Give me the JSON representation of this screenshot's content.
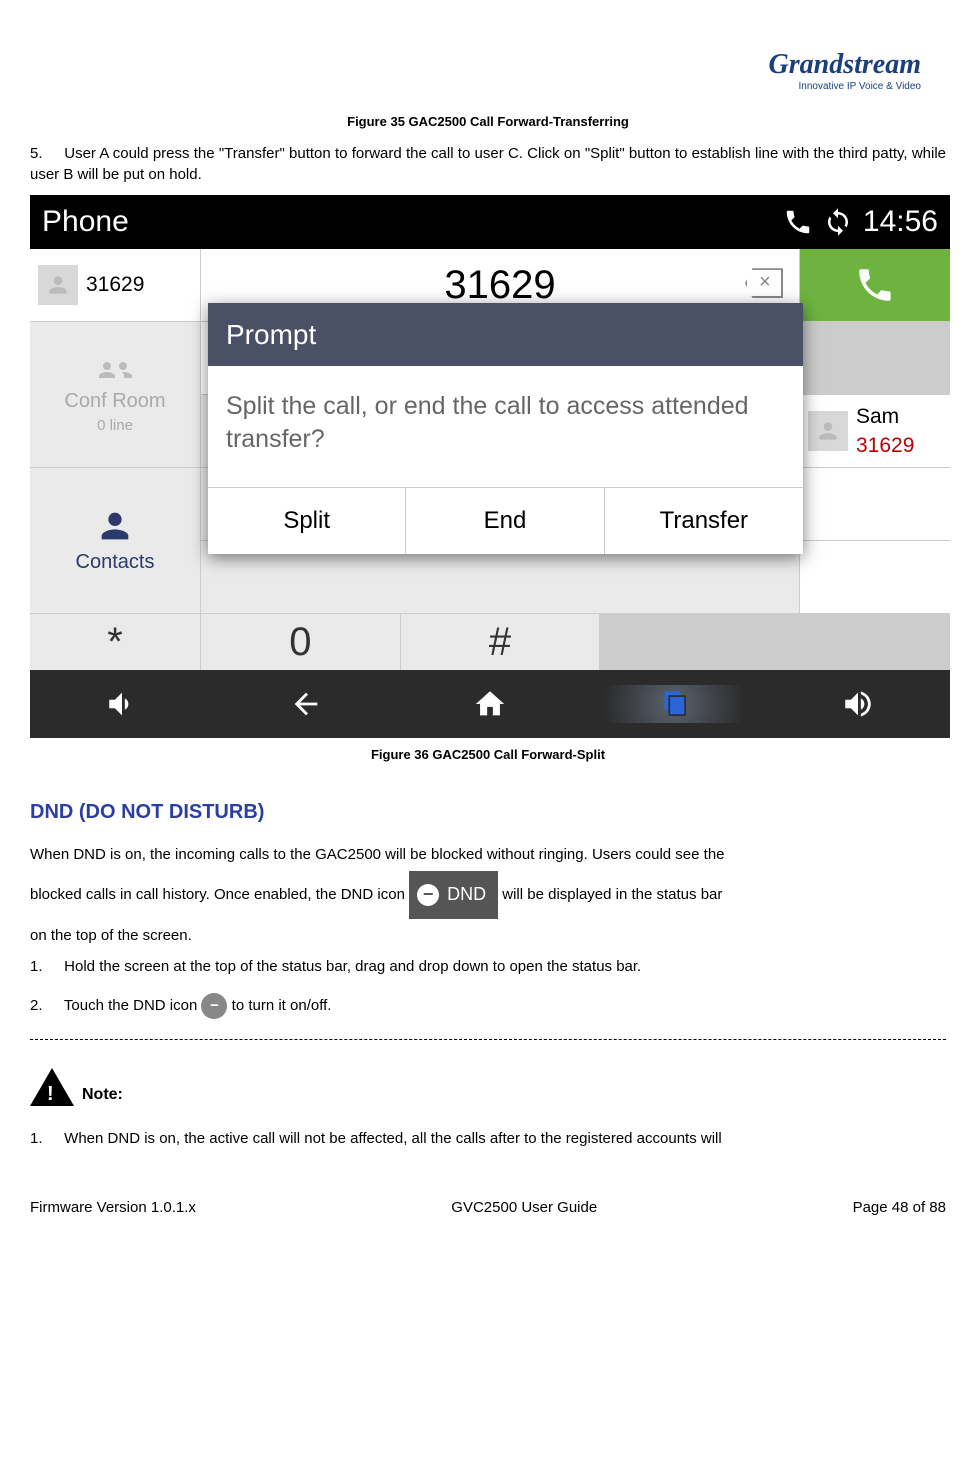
{
  "logo": {
    "brand": "Grandstream",
    "tag": "Innovative IP Voice & Video"
  },
  "caption35": "Figure 35 GAC2500 Call Forward-Transferring",
  "step5": {
    "num": "5.",
    "text": "User A could press the \"Transfer\" button to forward the call to user C. Click on \"Split\" button to establish line with the third patty, while user B will be put on hold."
  },
  "screenshot": {
    "statusbar": {
      "title": "Phone",
      "time": "14:56"
    },
    "num_field": "31629",
    "left": [
      {
        "name": "31629",
        "sub": ""
      },
      {
        "name": "31629",
        "sub": "31629"
      },
      {
        "name": "Sam",
        "sub": "31629"
      }
    ],
    "right": {
      "conf": "Conf Room",
      "conf_sub": "0 line",
      "contacts": "Contacts"
    },
    "keys": {
      "star": "*",
      "zero": "0",
      "hash": "#"
    },
    "prompt": {
      "title": "Prompt",
      "body": "Split the call, or end the call to access attended transfer?",
      "b1": "Split",
      "b2": "End",
      "b3": "Transfer"
    }
  },
  "caption36": "Figure 36 GAC2500 Call Forward-Split",
  "dnd_heading": "DND (DO NOT DISTURB)",
  "dnd_para_a": "When DND is on, the incoming calls to the GAC2500 will be blocked without ringing. Users could see the",
  "dnd_para_b": "blocked calls in call history. Once enabled, the DND icon ",
  "dnd_badge": "DND",
  "dnd_para_c": " will be displayed in the status bar",
  "dnd_para_d": "on the top of the screen.",
  "step1": {
    "num": "1.",
    "text": "Hold the screen at the top of the status bar, drag and drop down to open the status bar."
  },
  "step2": {
    "num": "2.",
    "pre": "Touch the DND icon ",
    "post": " to turn it on/off."
  },
  "note_label": "Note:",
  "note1": {
    "num": "1.",
    "text": "When DND is on, the active call will not be affected, all the calls after to the registered accounts will"
  },
  "footer": {
    "left": "Firmware Version 1.0.1.x",
    "center": "GVC2500 User Guide",
    "right": "Page 48 of 88"
  }
}
